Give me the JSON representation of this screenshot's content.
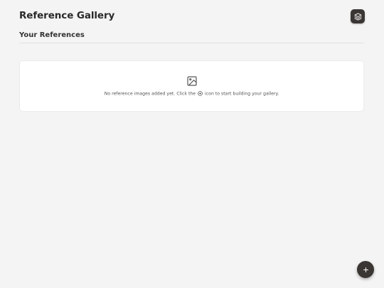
{
  "header": {
    "title": "Reference Gallery",
    "layers_icon": "layers-icon"
  },
  "section": {
    "title": "Your References"
  },
  "empty_state": {
    "icon": "image-icon",
    "message_before": "No reference images added yet. Click the",
    "inline_icon": "plus-circle-icon",
    "message_after": "icon to start building your gallery."
  },
  "fab": {
    "icon": "plus-icon"
  },
  "colors": {
    "background": "#f4f4f4",
    "card": "#ffffff",
    "accent_dark": "#3a3633"
  }
}
